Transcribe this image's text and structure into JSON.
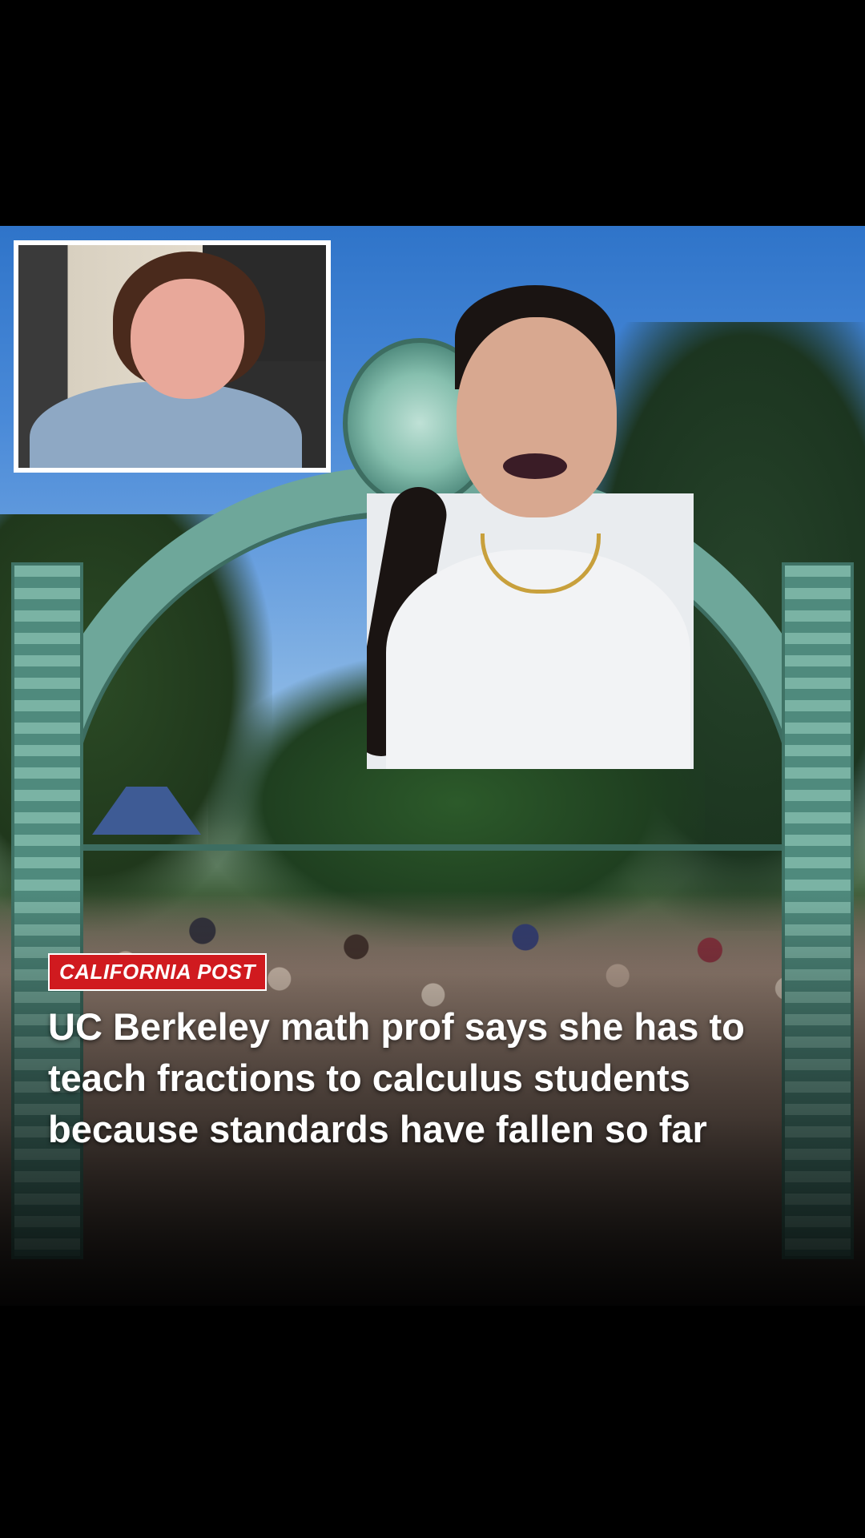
{
  "overlay": {
    "brand": "CALIFORNIA POST",
    "headline": "UC Berkeley math prof says she has to teach fractions to calculus students because standards have fallen so far"
  },
  "colors": {
    "brand_red": "#d01a1f",
    "headline_white": "#ffffff",
    "letterbox_black": "#000000"
  }
}
